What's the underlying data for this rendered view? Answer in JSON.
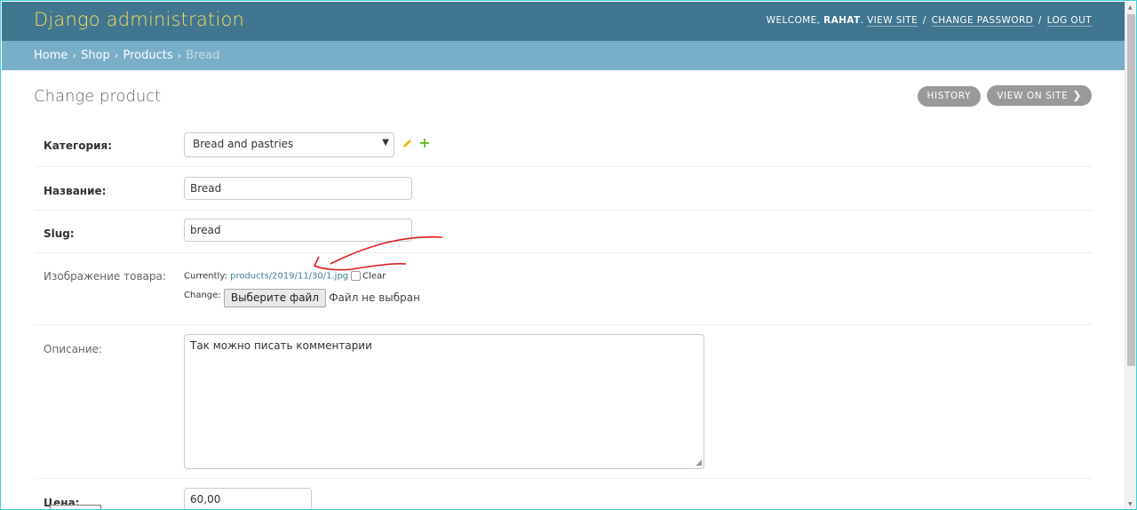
{
  "header": {
    "brand": "Django administration",
    "welcome": "WELCOME, ",
    "username": "RAHAT",
    "welcome_end": ".",
    "view_site": "VIEW SITE",
    "change_password": "CHANGE PASSWORD",
    "logout": "LOG OUT",
    "separator": "/"
  },
  "breadcrumbs": {
    "items": [
      "Home",
      "Shop",
      "Products"
    ],
    "current": "Bread",
    "separator": "›"
  },
  "page": {
    "title": "Change product",
    "history": "HISTORY",
    "view_on_site": "VIEW ON SITE",
    "view_on_site_chevron": "❯"
  },
  "form": {
    "category": {
      "label": "Категория:",
      "value": "Bread and pastries",
      "arrow": "▼"
    },
    "name": {
      "label": "Название:",
      "value": "Bread"
    },
    "slug": {
      "label": "Slug:",
      "value": "bread"
    },
    "image": {
      "label": "Изображение товара:",
      "currently_label": "Currently:",
      "currently_link": "products/2019/11/30/1.jpg",
      "clear_label": "Clear",
      "change_label": "Change:",
      "choose_button": "Выберите файл",
      "no_file": "Файл не выбран"
    },
    "description": {
      "label": "Описание:",
      "value": "Так можно писать комментарии"
    },
    "price": {
      "label": "Цена:",
      "value": "60,00"
    }
  },
  "colors": {
    "header_bg": "#417690",
    "brand": "#f5dd5d",
    "breadcrumb_bg": "#79aec8",
    "pill_bg": "#999999",
    "link": "#447e9b",
    "annotation": "#e01c1c"
  },
  "icons": {
    "edit": "pencil-icon",
    "add": "plus-icon"
  }
}
